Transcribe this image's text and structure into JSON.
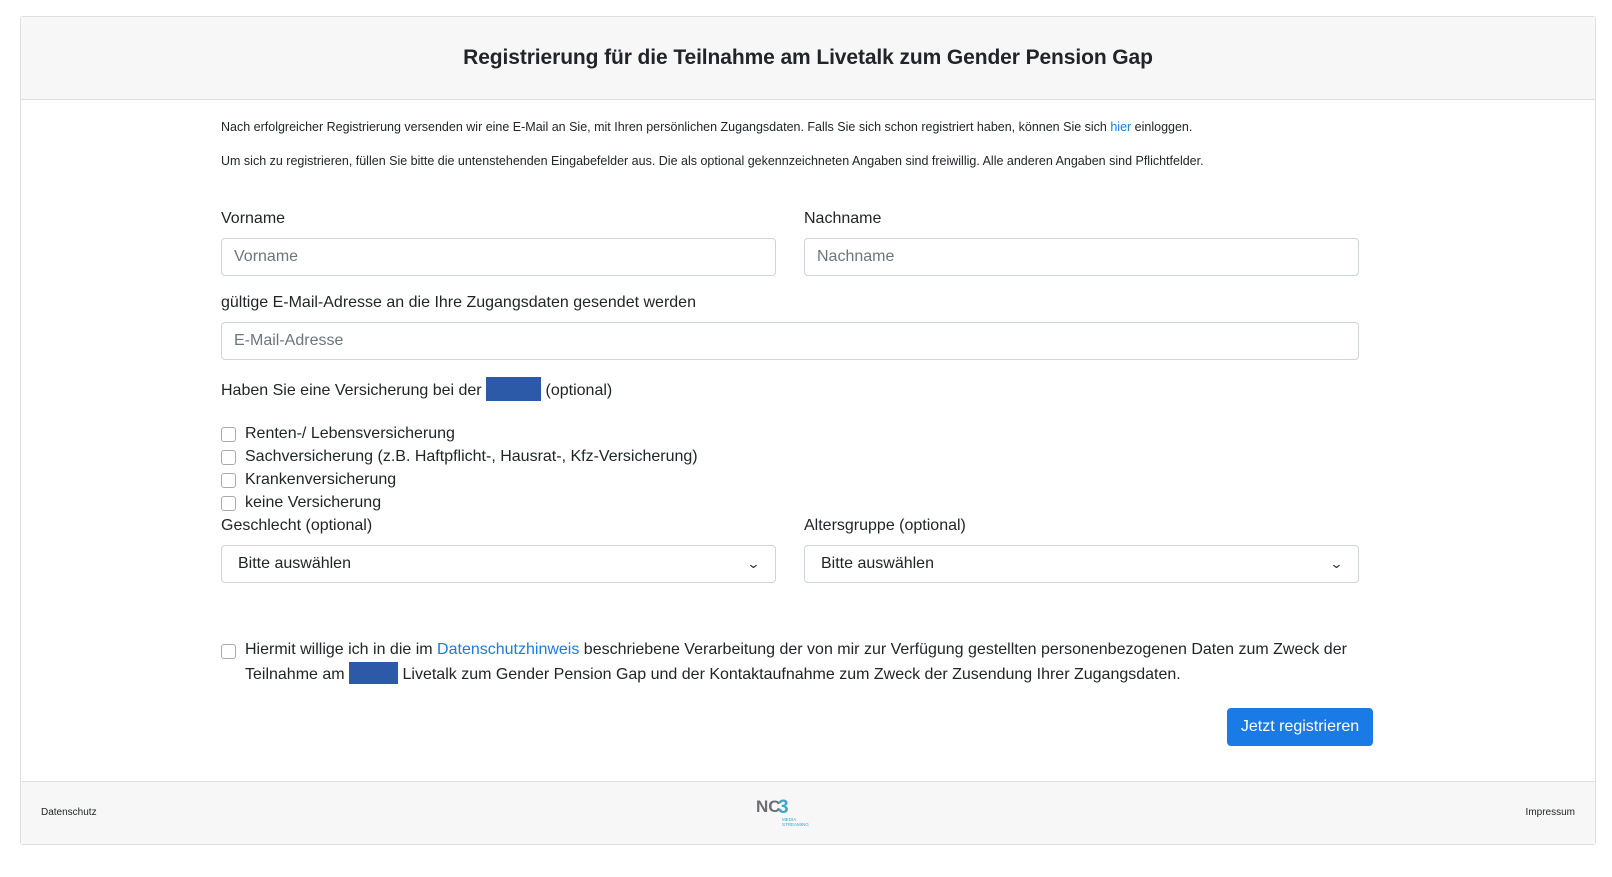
{
  "header": {
    "title": "Registrierung für die Teilnahme am Livetalk zum Gender Pension Gap"
  },
  "intro": {
    "line1_before": "Nach erfolgreicher Registrierung versenden wir eine E-Mail an Sie, mit Ihren persönlichen Zugangsdaten. Falls Sie sich schon registriert haben, können Sie sich ",
    "line1_link": "hier",
    "line1_after": " einloggen.",
    "line2": "Um sich zu registrieren, füllen Sie bitte die untenstehenden Eingabefelder aus. Die als optional gekennzeichneten Angaben sind freiwillig. Alle anderen Angaben sind Pflichtfelder."
  },
  "form": {
    "firstname": {
      "label": "Vorname",
      "placeholder": "Vorname",
      "value": ""
    },
    "lastname": {
      "label": "Nachname",
      "placeholder": "Nachname",
      "value": ""
    },
    "email": {
      "label": "gültige E-Mail-Adresse an die Ihre Zugangsdaten gesendet werden",
      "placeholder": "E-Mail-Adresse",
      "value": ""
    },
    "insurance": {
      "label_before": "Haben Sie eine Versicherung bei der",
      "label_after": "(optional)",
      "options": [
        {
          "label": "Renten-/ Lebensversicherung",
          "checked": false
        },
        {
          "label": "Sachversicherung (z.B. Haftpflicht-, Hausrat-, Kfz-Versicherung)",
          "checked": false
        },
        {
          "label": "Krankenversicherung",
          "checked": false
        },
        {
          "label": "keine Versicherung",
          "checked": false
        }
      ]
    },
    "gender": {
      "label": "Geschlecht (optional)",
      "selected": "Bitte auswählen"
    },
    "agegroup": {
      "label": "Altersgruppe (optional)",
      "selected": "Bitte auswählen"
    },
    "consent": {
      "checked": false,
      "text_before": "Hiermit willige ich in die im ",
      "link": "Datenschutzhinweis",
      "text_middle": " beschriebene Verarbeitung der von mir zur Verfügung gestellten personenbezogenen Daten zum Zweck der Teilnahme am ",
      "text_after": " Livetalk zum Gender Pension Gap und der Kontaktaufnahme zum Zweck der Zusendung Ihrer Zugangsdaten."
    },
    "submit_label": "Jetzt registrieren"
  },
  "footer": {
    "left_link": "Datenschutz",
    "right_link": "Impressum",
    "logo": {
      "main": "NC",
      "digit": "3",
      "sub1": "MEDIA",
      "sub2": "STREAMING"
    }
  },
  "colors": {
    "accent": "#1a7be6",
    "redaction": "#2c5aa9",
    "logo_gray": "#6d6e71",
    "logo_cyan": "#3aa6c8"
  }
}
